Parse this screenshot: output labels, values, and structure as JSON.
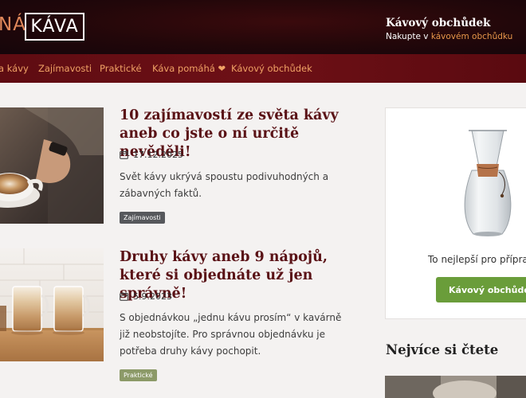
{
  "header": {
    "logo_left": "NÁ",
    "logo_box": "KÁVA",
    "title": "Kávový obchůdek",
    "subtitle_prefix": "Nakupte v ",
    "subtitle_link": "kávovém obchůdku"
  },
  "nav": {
    "items": [
      {
        "label": "a kávy"
      },
      {
        "label": "Zajímavosti"
      },
      {
        "label": "Praktické"
      },
      {
        "label": "Káva pomáhá ❤"
      },
      {
        "label": "Kávový obchůdek"
      }
    ]
  },
  "articles": [
    {
      "title": "10 zajímavostí ze světa kávy aneb co jste o ní určitě nevěděli!",
      "date": "17.12.2025",
      "excerpt": "Svět kávy ukrývá spoustu podivuhodných a zábavných faktů.",
      "category": "Zajímavosti"
    },
    {
      "title": "Druhy kávy aneb 9 nápojů, které si objednáte už jen správně!",
      "date": "5.9.2023",
      "excerpt": "S objednávkou „jednu kávu prosím“ v kavárně již neobstojíte. Pro správnou objednávku je potřeba druhy kávy pochopit.",
      "category": "Praktické"
    }
  ],
  "sidebar": {
    "promo_text": "To nejlepší pro příprav",
    "button_label": "Kávový obchůdek",
    "heading": "Nejvíce si čtete"
  },
  "colors": {
    "header_bg": "#22070a",
    "nav_bg": "#6e1016",
    "accent_orange": "#e8974a",
    "title_maroon": "#5a1216",
    "button_green": "#6a9d3a"
  }
}
